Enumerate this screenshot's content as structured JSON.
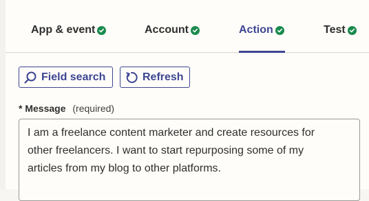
{
  "tabs": [
    {
      "label": "App & event",
      "completed": true
    },
    {
      "label": "Account",
      "completed": true
    },
    {
      "label": "Action",
      "completed": true,
      "active": true
    },
    {
      "label": "Test",
      "completed": true
    }
  ],
  "toolbar": {
    "field_search_label": "Field search",
    "refresh_label": "Refresh"
  },
  "message_field": {
    "required_marker": "*",
    "label": "Message",
    "hint": "(required)",
    "value": "I am a freelance content marketer and create resources for\nother freelancers. I want to start repurposing some of my\narticles from my blog to other platforms."
  },
  "colors": {
    "accent": "#3d4592",
    "success": "#1a8b4e",
    "background": "#fffdf9"
  },
  "icons": {
    "completed": "check-circle-icon",
    "field_search": "search-icon",
    "refresh": "refresh-icon"
  }
}
